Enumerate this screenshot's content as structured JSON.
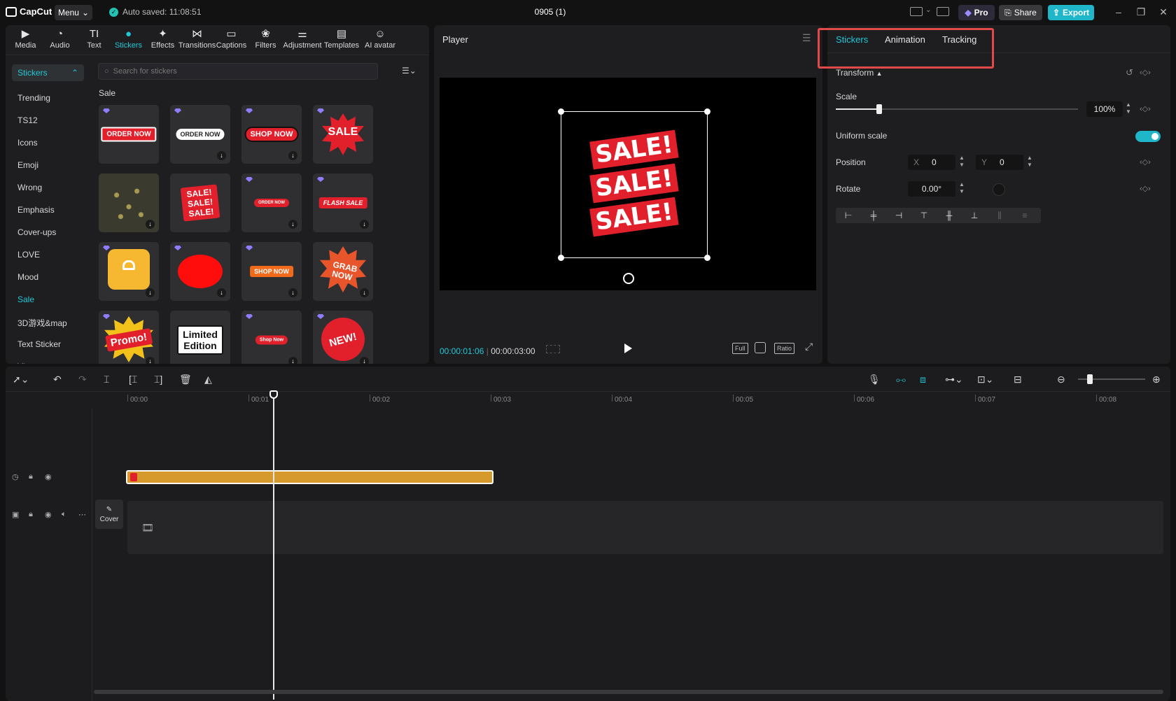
{
  "titlebar": {
    "logo": "CapCut",
    "menu_label": "Menu",
    "autosave": "Auto saved: 11:08:51",
    "project_title": "0905 (1)",
    "pro_label": "Pro",
    "share_label": "Share",
    "export_label": "Export"
  },
  "media_toolbar": [
    {
      "label": "Media",
      "icon": "media-icon"
    },
    {
      "label": "Audio",
      "icon": "audio-icon"
    },
    {
      "label": "Text",
      "icon": "text-icon"
    },
    {
      "label": "Stickers",
      "icon": "stickers-icon",
      "active": true
    },
    {
      "label": "Effects",
      "icon": "effects-icon"
    },
    {
      "label": "Transitions",
      "icon": "transitions-icon"
    },
    {
      "label": "Captions",
      "icon": "captions-icon"
    },
    {
      "label": "Filters",
      "icon": "filters-icon"
    },
    {
      "label": "Adjustment",
      "icon": "adjustment-icon"
    },
    {
      "label": "Templates",
      "icon": "templates-icon"
    },
    {
      "label": "AI avatar",
      "icon": "ai-avatar-icon"
    }
  ],
  "stickers": {
    "category_head": "Stickers",
    "categories": [
      "Trending",
      "TS12",
      "Icons",
      "Emoji",
      "Wrong",
      "Emphasis",
      "Cover-ups",
      "LOVE",
      "Mood",
      "Sale",
      "3D游戏&map",
      "Text Sticker",
      "Vlog"
    ],
    "active_category": "Sale",
    "search_placeholder": "Search for stickers",
    "section_title": "Sale",
    "items": [
      {
        "text": "ORDER NOW"
      },
      {
        "text": "ORDER NOW"
      },
      {
        "text": "SHOP NOW"
      },
      {
        "text": "SALE"
      },
      {
        "text": ""
      },
      {
        "text": "SALE! SALE! SALE!"
      },
      {
        "text": "ORDER NOW"
      },
      {
        "text": "FLASH SALE"
      },
      {
        "text": ""
      },
      {
        "text": ""
      },
      {
        "text": "SHOP NOW"
      },
      {
        "text": "GRAB NOW"
      },
      {
        "text": "Promo!"
      },
      {
        "text": "Limited Edition"
      },
      {
        "text": "Shop Now"
      },
      {
        "text": "NEW!"
      }
    ]
  },
  "player": {
    "title": "Player",
    "sale_text": "SALE!",
    "current_time": "00:00:01:06",
    "total_time": "00:00:03:00",
    "full_label": "Full",
    "ratio_label": "Ratio"
  },
  "inspector": {
    "tabs": [
      "Stickers",
      "Animation",
      "Tracking"
    ],
    "active_tab": "Stickers",
    "transform_label": "Transform",
    "scale_label": "Scale",
    "scale_value": "100%",
    "scale_fraction": 0.18,
    "uniform_scale_label": "Uniform scale",
    "uniform_scale_on": true,
    "position_label": "Position",
    "x_label": "X",
    "x_value": "0",
    "y_label": "Y",
    "y_value": "0",
    "rotate_label": "Rotate",
    "rotate_value": "0.00°"
  },
  "timeline": {
    "ruler_labels": [
      "00:00",
      "00:01",
      "00:02",
      "00:03",
      "00:04",
      "00:05",
      "00:06",
      "00:07",
      "00:08"
    ],
    "cover_label": "Cover"
  },
  "colors": {
    "accent": "#22c7d6",
    "export": "#1fb6c9",
    "clip": "#d59a2b",
    "sale_red": "#e2202c",
    "highlight": "#e04a4a"
  }
}
